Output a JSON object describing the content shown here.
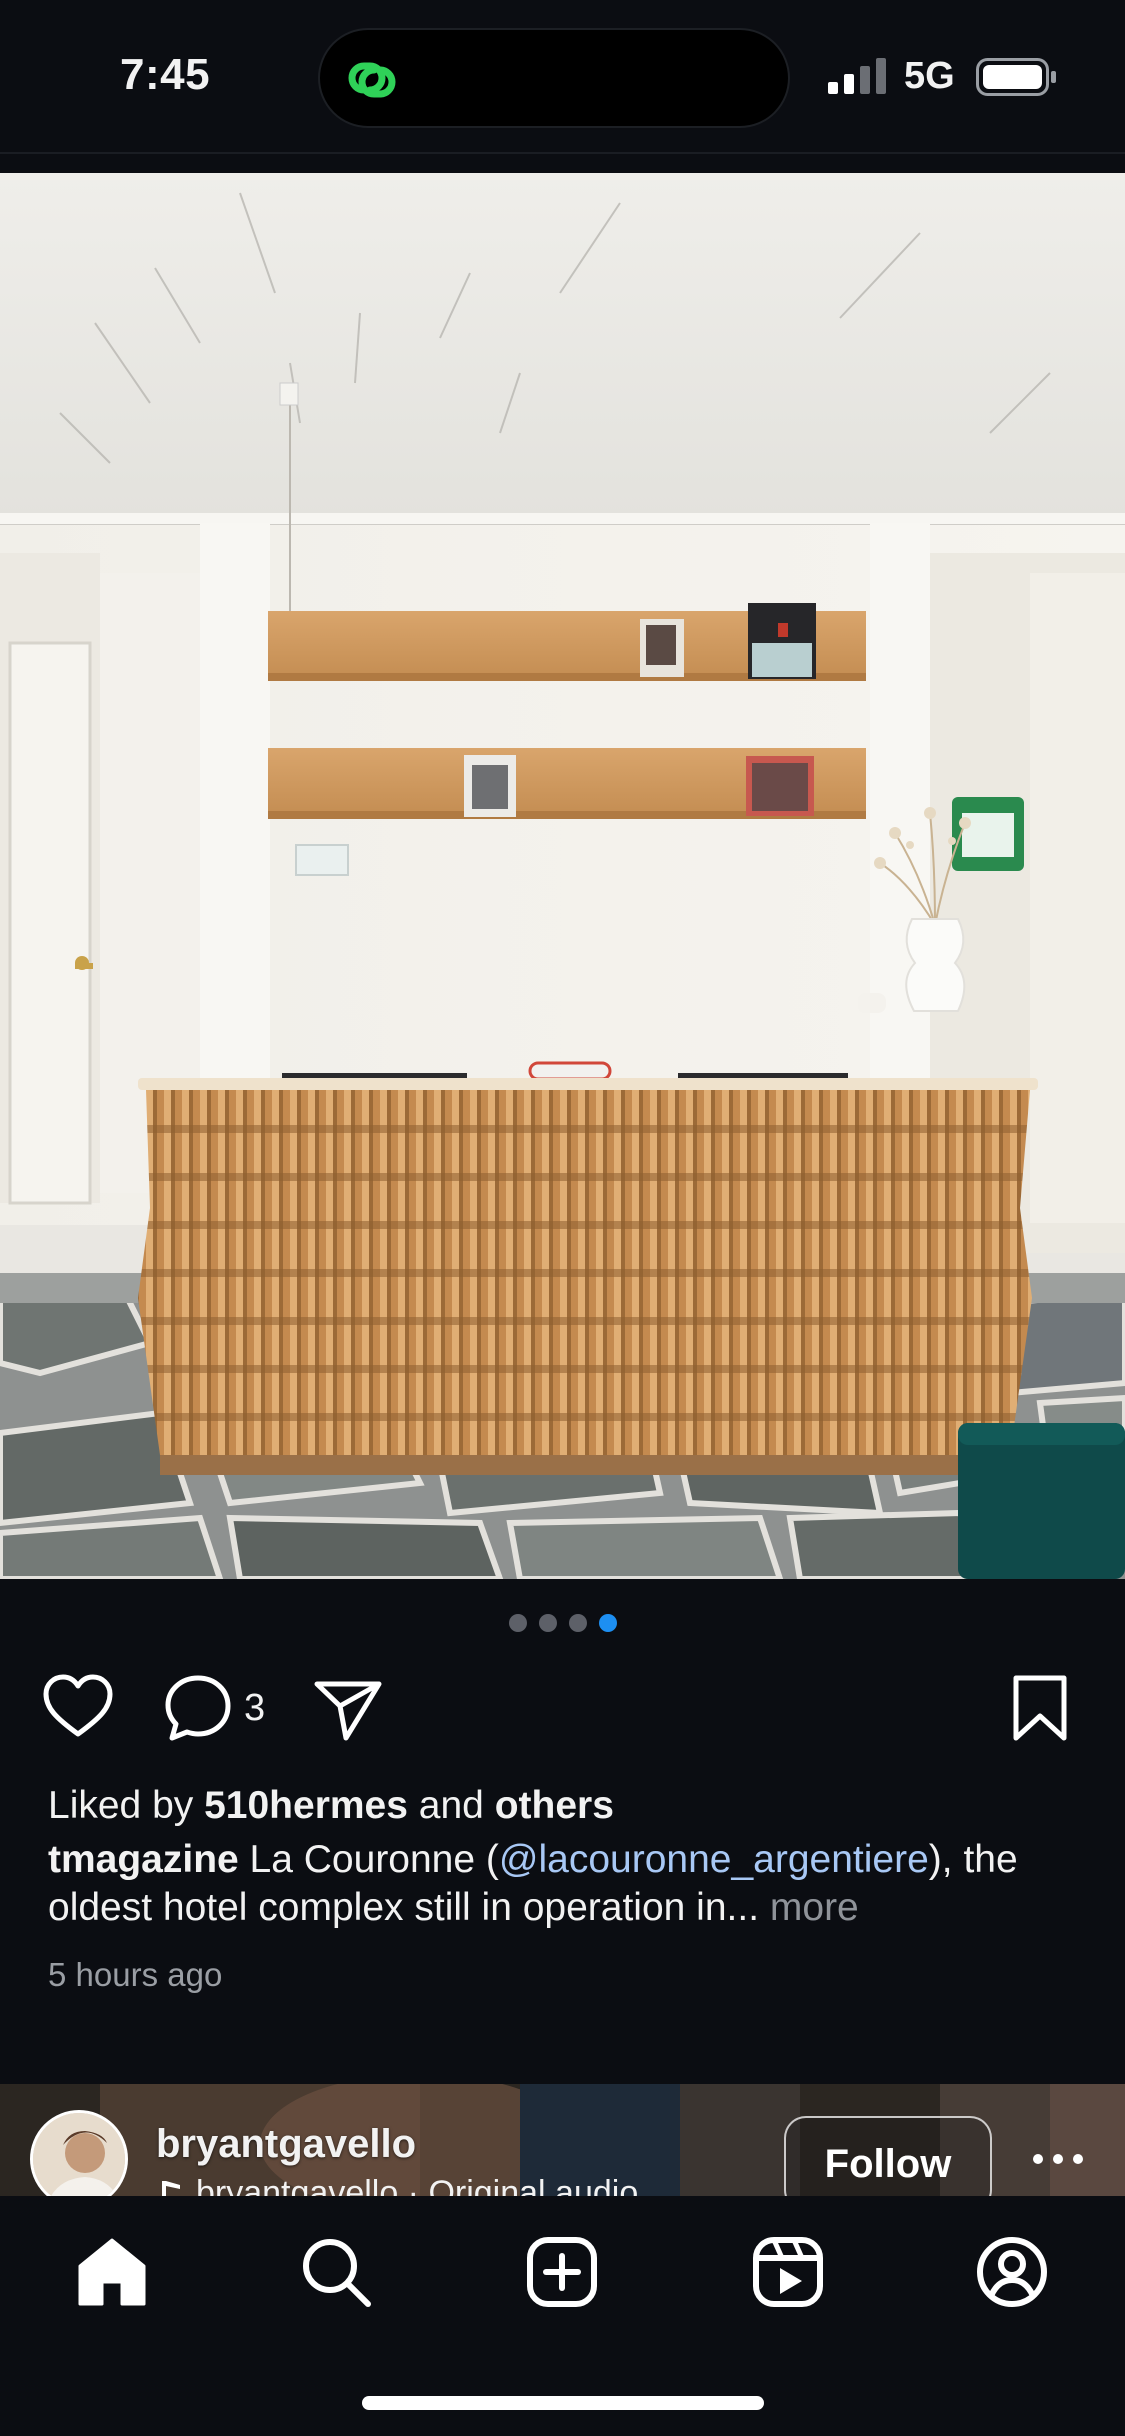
{
  "status_bar": {
    "time": "7:45",
    "network": "5G"
  },
  "carousel": {
    "count": 4,
    "active_index": 3
  },
  "actions": {
    "comment_count": "3"
  },
  "likes": {
    "prefix": "Liked by ",
    "user": "510hermes",
    "middle": " and ",
    "others": "others"
  },
  "caption": {
    "username": "tmagazine",
    "text_before": " La Couronne (",
    "mention": "@lacouronne_argentiere",
    "text_after": "), the oldest hotel complex still in operation in... ",
    "more": "more"
  },
  "timestamp": "5 hours ago",
  "next_post": {
    "username": "bryantgavello",
    "audio": "bryantgavello · Original audio",
    "follow_label": "Follow"
  },
  "colors": {
    "background": "#0b0d12",
    "accent_blue": "#1d8ff2",
    "mention": "#a8c8f5",
    "island_icon": "#2fd158"
  },
  "icons": [
    "threads-icon",
    "signal-icon",
    "battery-icon",
    "heart-icon",
    "comment-icon",
    "share-icon",
    "bookmark-icon",
    "audio-icon",
    "more-icon",
    "home-icon",
    "search-icon",
    "create-icon",
    "reels-icon",
    "profile-icon"
  ]
}
